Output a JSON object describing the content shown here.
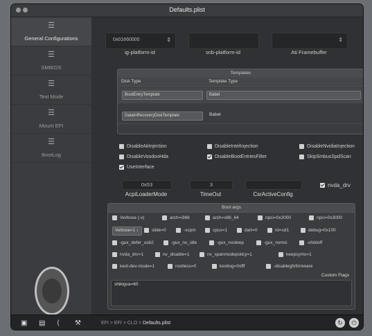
{
  "window": {
    "title": "Defaults.plist"
  },
  "sidebar": {
    "items": [
      {
        "label": "General Configurations",
        "active": true
      },
      {
        "label": "SMBIOS"
      },
      {
        "label": "Text Mode"
      },
      {
        "label": "Mount EFI"
      },
      {
        "label": "BootLog"
      }
    ]
  },
  "fields": {
    "ig_platform_value": "0x01660000",
    "ig_platform_label": "ig-platform-id",
    "snb_label": "snb-platform-id",
    "ati_label": "Ati Framebuffer"
  },
  "templates": {
    "title": "Templates",
    "col1": "Disk Type",
    "col2": "Template Type",
    "rows": [
      {
        "disk": "BootEntryTemplate",
        "template": "Babel"
      },
      {
        "disk": "DataInRecoveryDiskTemplate",
        "template": "Babel"
      }
    ]
  },
  "options": {
    "disable_ati": "DisableAtiInjection",
    "disable_intel": "DisableIntelInjection",
    "disable_nvidia": "DisableNvidiaInjection",
    "disable_voodoo": "DisableVoodooHda",
    "disable_boot_entries": "DisableBootEntriesFilter",
    "skip_smbus": "SkipSmbusSpdScan",
    "use_interface": "UseInterface"
  },
  "numbers": {
    "acpi_value": "0x53",
    "acpi_label": "AcpiLoaderMode",
    "timeout_value": "3",
    "timeout_label": "TimeOut",
    "csr_label": "CsrActiveConfig",
    "nvda_label": "nvda_drv"
  },
  "boot": {
    "title": "Boot args",
    "args": [
      "Verbose (-v)",
      "arch=i386",
      "arch=x86_64",
      "npci=0x2000",
      "npci=0x3000",
      "Verbose=1 ↕",
      "slide=0",
      "-xcpm",
      "cpus=1",
      "dart=0",
      "rd=cd1",
      "debug=0x100",
      "-gux_defer_usb2",
      "-gux_no_idle",
      "-gux_nosleep",
      "-gux_nomsi",
      "-shikioff",
      "nvda_drv=1",
      "nv_disable=1",
      "nv_spanmodepolicy=1",
      "keepsyms=1",
      "kext-dev-mode=1",
      "rootless=0",
      "kextlog=0xfff",
      "-disablegfxfirmware"
    ],
    "custom_label": "Custom Flags",
    "custom_value": "shikigva=60"
  },
  "bottom": {
    "path_prefix": "EFI > EFI > CLO >",
    "path_file": "Defaults.plist"
  }
}
